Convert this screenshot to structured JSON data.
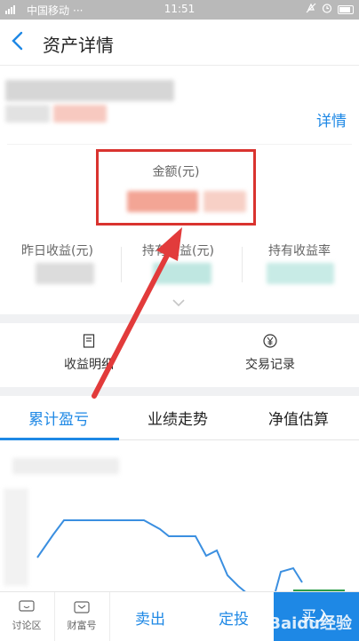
{
  "status_bar": {
    "carrier": "中国移动",
    "dots": "···",
    "time": "11:51"
  },
  "header": {
    "back_icon": "chevron-left-icon",
    "title": "资产详情"
  },
  "fund": {
    "detail_link": "详情"
  },
  "amount": {
    "label": "金额(元)"
  },
  "stats": [
    {
      "label": "昨日收益(元)"
    },
    {
      "label": "持有收益(元)"
    },
    {
      "label": "持有收益率"
    }
  ],
  "actions": [
    {
      "label": "收益明细",
      "icon": "document-icon"
    },
    {
      "label": "交易记录",
      "icon": "yen-circle-icon"
    }
  ],
  "tabs": [
    {
      "label": "累计盈亏",
      "active": true
    },
    {
      "label": "业绩走势",
      "active": false
    },
    {
      "label": "净值估算",
      "active": false
    }
  ],
  "bottom_bar": {
    "discussion": "讨论区",
    "wealth": "财富号",
    "sell": "卖出",
    "auto_invest": "定投",
    "buy": "买入"
  },
  "colors": {
    "accent": "#1e88e5",
    "annotation": "#d9332f"
  },
  "watermark": "Baidu经验"
}
